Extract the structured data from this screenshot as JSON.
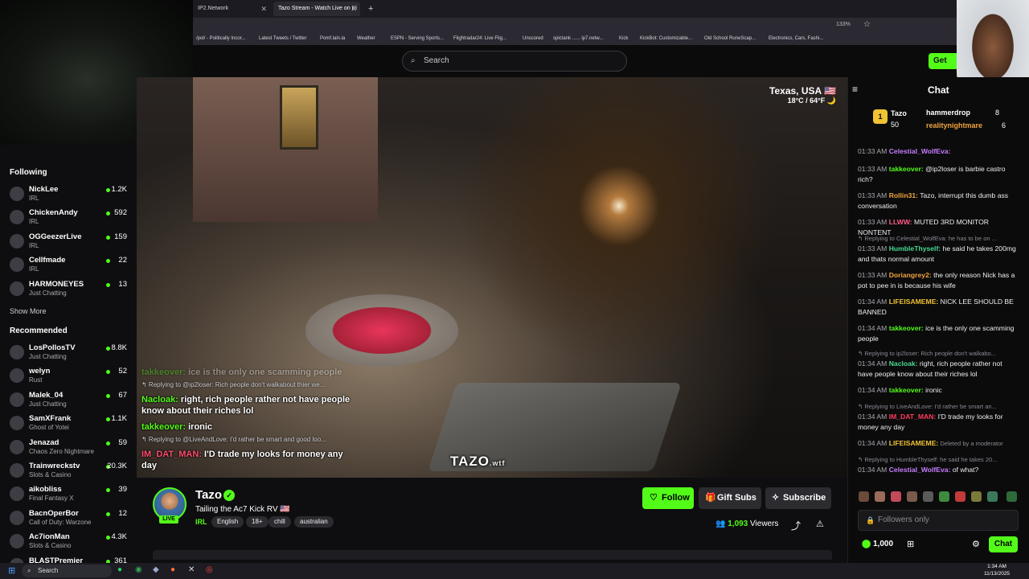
{
  "browser": {
    "tabs": [
      {
        "label": "IP2.Network",
        "active": false
      },
      {
        "label": "Tazo Stream - Watch Live on Ki",
        "active": true
      }
    ],
    "zoom": "133%",
    "bookmarks": [
      "/pol/ - Politically Incor...",
      "Latest Tweets / Twitter",
      "Pomf.lain.la",
      "Weather",
      "ESPN - Serving Sports...",
      "Flightradar24: Live Flig...",
      "Unscored",
      "spictank ...... ip7.netw...",
      "Kick",
      "KickBot: Customizable...",
      "Old School RuneScap...",
      "Electronics, Cars, Fashi..."
    ]
  },
  "header": {
    "search_placeholder": "Search",
    "get_app_label": "Get"
  },
  "sidebar": {
    "following_title": "Following",
    "following": [
      {
        "name": "NickLee",
        "category": "IRL",
        "viewers": "1.2K"
      },
      {
        "name": "ChickenAndy",
        "category": "IRL",
        "viewers": "592"
      },
      {
        "name": "OGGeezerLive",
        "category": "IRL",
        "viewers": "159"
      },
      {
        "name": "Cellfmade",
        "category": "IRL",
        "viewers": "22"
      },
      {
        "name": "HARMONEYES",
        "category": "Just Chatting",
        "viewers": "13"
      }
    ],
    "show_more": "Show More",
    "recommended_title": "Recommended",
    "recommended": [
      {
        "name": "LosPollosTV",
        "category": "Just Chatting",
        "viewers": "8.8K"
      },
      {
        "name": "welyn",
        "category": "Rust",
        "viewers": "52"
      },
      {
        "name": "Malek_04",
        "category": "Just Chatting",
        "viewers": "67"
      },
      {
        "name": "SamXFrank",
        "category": "Ghost of Yotei",
        "viewers": "1.1K"
      },
      {
        "name": "Jenazad",
        "category": "Chaos Zero Nightmare",
        "viewers": "59"
      },
      {
        "name": "Trainwreckstv",
        "category": "Slots & Casino",
        "viewers": "20.3K"
      },
      {
        "name": "aikobliss",
        "category": "Final Fantasy X",
        "viewers": "39"
      },
      {
        "name": "BacnOperBor",
        "category": "Call of Duty: Warzone",
        "viewers": "12"
      },
      {
        "name": "Ac7ionMan",
        "category": "Slots & Casino",
        "viewers": "4.3K"
      },
      {
        "name": "BLASTPremier",
        "category": "",
        "viewers": "361"
      }
    ]
  },
  "video": {
    "location": "Texas, USA 🇺🇸",
    "weather": "18°C / 64°F 🌙",
    "logo_text": "TAZO",
    "logo_suffix": ".wtf",
    "overlay_chat": [
      {
        "kind": "msg",
        "user": "takkeover:",
        "text": " ice is the only one scamming people",
        "faded": true
      },
      {
        "kind": "reply",
        "text": "↰ Replying to @ip2loser: Rich people don't walkabout thier we..."
      },
      {
        "kind": "msg",
        "user": "Nacloak:",
        "text": " right, rich people rather not have people know about their riches lol"
      },
      {
        "kind": "msg",
        "user": "takkeover:",
        "text": " ironic"
      },
      {
        "kind": "reply",
        "text": "↰ Replying to @LiveAndLove: I'd rather be smart and good loo..."
      },
      {
        "kind": "msg",
        "user": "IM_DAT_MAN:",
        "text": " I'D trade my looks for money any day",
        "red": true
      }
    ]
  },
  "channel": {
    "name": "Tazo",
    "title": "Tailing the Ac7 Kick RV 🇺🇸",
    "category": "IRL",
    "tags": [
      "English",
      "18+",
      "chill",
      "australian"
    ],
    "live_label": "LIVE",
    "follow_label": "Follow",
    "gift_label": "Gift Subs",
    "subscribe_label": "Subscribe",
    "viewers": "1,093",
    "viewers_label": "Viewers"
  },
  "chat": {
    "title": "Chat",
    "leaderboard": {
      "rank": "1",
      "top_name": "Tazo",
      "top_count": "50",
      "second_name": "hammerdrop",
      "second_count": "8",
      "third_name": "realitynightmare",
      "third_count": "6"
    },
    "messages": [
      {
        "time": "01:33 AM",
        "user": "Celestial_WolfEva:",
        "text": "",
        "color": "#c77dff"
      },
      {
        "time": "01:33 AM",
        "user": "takkeover:",
        "text": " @ip2loser is barbie castro rich?",
        "color": "#53fc18"
      },
      {
        "time": "01:33 AM",
        "user": "Rollin31:",
        "text": " Tazo, interrupt this dumb ass conversation",
        "color": "#f1a33c"
      },
      {
        "time": "01:33 AM",
        "user": "LLWW:",
        "text": " MUTED 3RD MONITOR NONTENT",
        "color": "#ff5c8a"
      },
      {
        "reply": "↰ Replying to Celestial_WolfEva: he has to be on ..."
      },
      {
        "time": "01:33 AM",
        "user": "HumbleThyself:",
        "text": " he said he takes 200mg and thats normal amount",
        "color": "#4ad991"
      },
      {
        "time": "01:33 AM",
        "user": "Doriangrey2:",
        "text": " the only reason Nick has a pot to pee in is because his wife",
        "color": "#f1a33c"
      },
      {
        "time": "01:34 AM",
        "user": "LIFEISAMEME:",
        "text": " NICK LEE SHOULD BE BANNED",
        "color": "#f1c232"
      },
      {
        "time": "01:34 AM",
        "user": "takkeover:",
        "text": " ice is the only one scamming people",
        "color": "#53fc18"
      },
      {
        "reply": "↰ Replying to ip2loser: Rich people don't walkabo..."
      },
      {
        "time": "01:34 AM",
        "user": "Nacloak:",
        "text": " right, rich people rather not have people know about their riches lol",
        "color": "#4ad991"
      },
      {
        "time": "01:34 AM",
        "user": "takkeover:",
        "text": " ironic",
        "color": "#53fc18"
      },
      {
        "reply": "↰ Replying to LiveAndLove: I'd rather be smart an..."
      },
      {
        "time": "01:34 AM",
        "user": "IM_DAT_MAN:",
        "text": " I'D trade my looks for money any day",
        "color": "#ff3b5c"
      },
      {
        "time": "01:34 AM",
        "user": "LIFEISAMEME:",
        "text": " Deleted by a moderator",
        "color": "#f1c232",
        "deleted": true
      },
      {
        "reply": "↰ Replying to HumbleThyself: he said he takes 20..."
      },
      {
        "time": "01:34 AM",
        "user": "Celestial_WolfEva:",
        "text": " of what?",
        "color": "#c77dff"
      }
    ],
    "input_placeholder": "Followers only",
    "points": "1,000",
    "send_label": "Chat"
  },
  "taskbar": {
    "search_label": "Search",
    "time": "1:34 AM",
    "date": "11/13/2025"
  }
}
